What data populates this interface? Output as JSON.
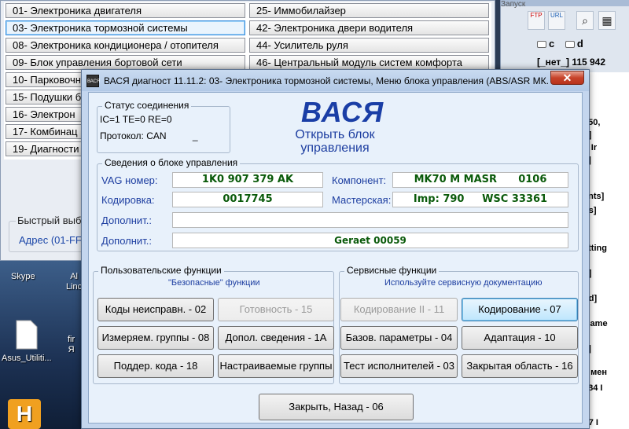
{
  "modules_left": [
    "01- Электроника двигателя",
    "03- Электроника тормозной системы",
    "08- Электроника кондиционера / отопителя",
    "09- Блок управления бортовой сети",
    "10- Парковочн",
    "15- Подушки б",
    "16- Электрон",
    "17- Комбинац",
    "19- Диагности"
  ],
  "modules_right": [
    "25- Иммобилайзер",
    "42- Электроника двери водителя",
    "44- Усилитель руля",
    "46- Центральный модуль систем комфорта"
  ],
  "quick": {
    "title": "Быстрый выб",
    "address": "Адрес (01-FF"
  },
  "right_window": {
    "caption": "Запуск",
    "icon_ftp": "FTP",
    "icon_url": "URL",
    "radio_c": "c",
    "radio_d": "d",
    "status_line": "[_нет_]  115 942",
    "fragments": [
      "750,",
      "d]",
      "n Ir",
      "s]",
      "ents]",
      "ds]",
      "etting",
      "d]",
      "od]",
      "Game",
      "s]",
      "е мен",
      "784 I",
      "F7 I"
    ]
  },
  "desktop": {
    "icons": [
      "Skype",
      "Al\nLinc",
      "Asus_Utiliti...",
      "fir\nЯ",
      "H"
    ]
  },
  "dialog": {
    "icon": "ВАСЯ",
    "title": "ВАСЯ диагност 11.11.2: 03- Электроника тормозной системы,  Меню блока управления (ABS/ASR МК...",
    "close": "✕",
    "connection": {
      "title": "Статус соединения",
      "line1": "IC=1  TE=0   RE=0",
      "line2": "Протокол: CAN          _"
    },
    "logo": "ВАСЯ",
    "open_block": "Открыть блок управления",
    "info": {
      "title": "Сведения о блоке управления",
      "vag_label": "VAG номер:",
      "vag_value": "1K0 907 379 AK",
      "component_label": "Компонент:",
      "component_value": "MK70 M MASR      0106",
      "coding_label": "Кодировка:",
      "coding_value": "0017745",
      "workshop_label": "Мастерская:",
      "workshop_value": "Imp: 790     WSC 33361",
      "extra1_label": "Дополнит.:",
      "extra1_value": "",
      "extra2_label": "Дополнит.:",
      "extra2_value": "Geraet 00059"
    },
    "user_funcs": {
      "title": "Пользовательские функции",
      "note": "\"Безопасные\" функции",
      "buttons": [
        "Коды неисправн. - 02",
        "Готовность - 15",
        "Измеряем. группы - 08",
        "Допол. сведения - 1A",
        "Поддер. кода - 18",
        "Настраиваемые группы"
      ]
    },
    "service_funcs": {
      "title": "Сервисные функции",
      "note": "Используйте сервисную документацию",
      "buttons": [
        "Кодирование II - 11",
        "Кодирование - 07",
        "Базов. параметры - 04",
        "Адаптация - 10",
        "Тест исполнителей - 03",
        "Закрытая область - 16"
      ]
    },
    "close_back": "Закрыть, Назад - 06"
  }
}
